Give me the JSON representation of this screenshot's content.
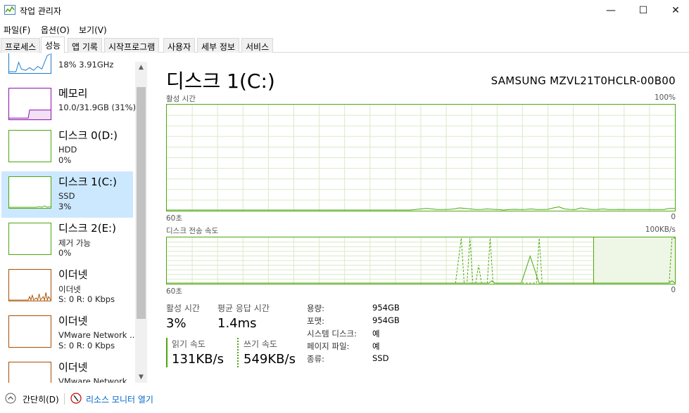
{
  "window": {
    "title": "작업 관리자",
    "minimize_glyph": "—",
    "maximize_glyph": "☐",
    "close_glyph": "✕"
  },
  "menu": [
    "파일(F)",
    "옵션(O)",
    "보기(V)"
  ],
  "tabs": [
    {
      "label": "프로세스",
      "active": false
    },
    {
      "label": "성능",
      "active": true
    },
    {
      "label": "앱 기록",
      "active": false
    },
    {
      "label": "시작프로그램",
      "active": false
    },
    {
      "label": "사용자",
      "active": false
    },
    {
      "label": "세부 정보",
      "active": false
    },
    {
      "label": "서비스",
      "active": false
    }
  ],
  "sidebar": {
    "items": [
      {
        "name": "",
        "sub1": "18% 3.91GHz",
        "sub2": "",
        "color": "#1979ca",
        "selected": false
      },
      {
        "name": "메모리",
        "sub1": "10.0/31.9GB (31%)",
        "sub2": "",
        "color": "#8b12ae",
        "selected": false
      },
      {
        "name": "디스크 0(D:)",
        "sub1": "HDD",
        "sub2": "0%",
        "color": "#4ca60c",
        "selected": false
      },
      {
        "name": "디스크 1(C:)",
        "sub1": "SSD",
        "sub2": "3%",
        "color": "#4ca60c",
        "selected": true
      },
      {
        "name": "디스크 2(E:)",
        "sub1": "제거 가능",
        "sub2": "0%",
        "color": "#4ca60c",
        "selected": false
      },
      {
        "name": "이더넷",
        "sub1": "이더넷",
        "sub2": "S: 0  R: 0 Kbps",
        "color": "#a74f01",
        "selected": false
      },
      {
        "name": "이더넷",
        "sub1": "VMware Network ...",
        "sub2": "S: 0  R: 0 Kbps",
        "color": "#a74f01",
        "selected": false
      },
      {
        "name": "이더넷",
        "sub1": "VMware Network",
        "sub2": "",
        "color": "#a74f01",
        "selected": false
      }
    ]
  },
  "main": {
    "title": "디스크 1(C:)",
    "model": "SAMSUNG MZVL21T0HCLR-00B00",
    "active_time_graph": {
      "label": "활성 시간",
      "max_label": "100%",
      "time_label": "60초",
      "min_label": "0",
      "samples": [
        0,
        0,
        0,
        0,
        0,
        0,
        0,
        0,
        0,
        0,
        0,
        0,
        0,
        0,
        0,
        0,
        0,
        0,
        0,
        0,
        0,
        0,
        0,
        0,
        0,
        0,
        0,
        0,
        0,
        0,
        0,
        0,
        0,
        0,
        0,
        0,
        0,
        0,
        0,
        0,
        0,
        0,
        0,
        0,
        0,
        0.5,
        1,
        1.5,
        1,
        0.5,
        0.5,
        0.6,
        1,
        2,
        1.5,
        1,
        0.5,
        0.6,
        1,
        0.7,
        0.5,
        0,
        0.5,
        0.7,
        0.5,
        0.6,
        1,
        0.5,
        0.5,
        0.7,
        2,
        3,
        1,
        0.6,
        0.5,
        2,
        1,
        0.5,
        0.6,
        1,
        0.5,
        0.5,
        0.6,
        0.5,
        0.5,
        0.5,
        0.5,
        0.5,
        0.5,
        0.5,
        0.5,
        1.5,
        1.5
      ]
    },
    "transfer_graph": {
      "label": "디스크 전송 속도",
      "max_label": "100KB/s",
      "time_label": "60초",
      "min_label": "0",
      "read_samples": [
        0,
        0,
        0,
        0,
        0,
        0,
        0,
        0,
        0,
        0,
        0,
        0,
        0,
        0,
        0,
        0,
        0,
        0,
        0,
        0,
        0,
        0,
        0,
        0,
        0,
        0,
        0,
        0,
        0,
        0,
        0,
        0,
        0,
        0,
        0,
        0,
        0,
        0,
        0,
        0,
        0,
        0,
        0,
        0,
        0,
        0,
        0,
        0,
        0,
        0,
        0,
        0,
        0,
        0,
        0,
        0,
        0,
        0,
        0,
        0,
        0,
        0,
        0,
        0,
        0,
        0,
        0,
        0,
        0,
        0,
        0,
        0,
        0,
        0,
        0,
        0,
        0,
        0,
        0,
        0,
        0,
        0,
        0,
        0,
        0,
        0,
        0,
        0,
        0,
        0,
        0,
        0,
        0,
        0,
        0,
        0,
        0,
        0,
        0,
        0,
        0,
        0,
        0,
        0,
        0,
        0,
        0,
        0,
        0,
        0,
        5,
        0,
        0,
        0,
        0,
        0,
        0,
        0,
        0,
        0,
        0,
        20,
        40,
        60,
        40,
        20,
        0,
        0,
        0,
        0,
        0,
        0,
        0,
        0,
        0,
        0,
        0,
        0,
        0,
        0,
        0,
        0,
        0,
        0,
        0,
        0,
        0,
        0,
        0,
        0,
        0,
        0,
        0,
        0,
        0,
        0,
        0,
        0,
        0,
        0,
        0,
        0,
        0,
        0,
        0,
        0,
        0,
        0,
        0,
        0,
        0,
        5,
        0
      ],
      "write_samples": [
        0,
        0,
        0,
        0,
        0,
        0,
        0,
        0,
        0,
        0,
        0,
        0,
        0,
        0,
        0,
        0,
        0,
        0,
        0,
        0,
        0,
        0,
        0,
        0,
        0,
        0,
        0,
        0,
        0,
        0,
        0,
        0,
        0,
        0,
        0,
        0,
        0,
        0,
        0,
        0,
        0,
        0,
        0,
        0,
        0,
        0,
        0,
        0,
        0,
        0,
        0,
        0,
        0,
        0,
        0,
        0,
        0,
        0,
        0,
        0,
        0,
        0,
        0,
        0,
        0,
        0,
        0,
        0,
        0,
        0,
        0,
        0,
        0,
        0,
        0,
        0,
        0,
        0,
        0,
        0,
        0,
        0,
        0,
        0,
        0,
        0,
        0,
        0,
        0,
        0,
        0,
        0,
        0,
        0,
        0,
        0,
        0,
        0,
        0,
        0,
        0,
        50,
        100,
        0,
        0,
        100,
        0,
        0,
        40,
        0,
        0,
        0,
        100,
        0,
        0,
        0,
        0,
        0,
        0,
        0,
        0,
        0,
        0,
        0,
        0,
        0,
        0,
        0,
        0,
        100,
        0,
        0,
        0,
        0,
        0,
        0,
        0,
        0,
        0,
        0,
        0,
        0,
        0,
        0,
        0,
        0,
        0,
        0,
        0,
        0,
        0,
        0,
        0,
        0,
        0,
        0,
        0,
        0,
        0,
        0,
        0,
        0,
        0,
        0,
        0,
        0,
        0,
        0,
        0,
        0,
        0,
        0,
        0,
        0,
        0,
        100,
        100
      ]
    },
    "stats": {
      "active_time_label": "활성 시간",
      "active_time_value": "3%",
      "avg_response_label": "평균 응답 시간",
      "avg_response_value": "1.4ms",
      "read_speed_label": "읽기 속도",
      "read_speed_value": "131KB/s",
      "write_speed_label": "쓰기 속도",
      "write_speed_value": "549KB/s"
    },
    "info": [
      {
        "label": "용량:",
        "value": "954GB"
      },
      {
        "label": "포맷:",
        "value": "954GB"
      },
      {
        "label": "시스템 디스크:",
        "value": "예"
      },
      {
        "label": "페이지 파일:",
        "value": "예"
      },
      {
        "label": "종류:",
        "value": "SSD"
      }
    ]
  },
  "bottom": {
    "fewer_details_label": "간단히(D)",
    "resource_monitor_label": "리소스 모니터 열기"
  },
  "colors": {
    "disk_green": "#4ca60c",
    "grid_green": "#d9eac8",
    "selected_bg": "#cce8ff",
    "link_blue": "#0066cc"
  }
}
